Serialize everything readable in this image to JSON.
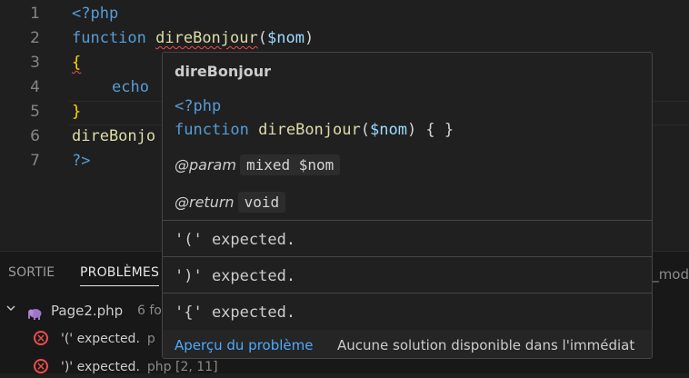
{
  "editor": {
    "lines": [
      {
        "num": "1"
      },
      {
        "num": "2"
      },
      {
        "num": "3"
      },
      {
        "num": "4"
      },
      {
        "num": "5"
      },
      {
        "num": "6"
      },
      {
        "num": "7"
      }
    ],
    "tok": {
      "php_open": "<?php",
      "kw_function": "function",
      "fn_name": "direBonjour",
      "paren_open": "(",
      "param": "$nom",
      "paren_close": ")",
      "brace_open": "{",
      "echo": "echo",
      "brace_close": "}",
      "call_partial": "direBonjo",
      "php_close": "?>"
    }
  },
  "hover": {
    "title": "direBonjour",
    "code_line1": "<?php",
    "code_kw": "function",
    "code_fn": "direBonjour",
    "code_paren_open": "(",
    "code_param": "$nom",
    "code_tail": ") { }",
    "param_tag": "@param",
    "param_value": "mixed $nom",
    "return_tag": "@return",
    "return_value": "void",
    "errors": [
      "'(' expected.",
      "')' expected.",
      "'{' expected."
    ],
    "footer_link": "Aperçu du problème",
    "footer_note": "Aucune solution disponible dans l'immédiat"
  },
  "panel": {
    "tab_output": "SORTIE",
    "tab_problems": "PROBLÈMES",
    "right_clip": "_mod",
    "file_name": "Page2.php",
    "file_count": "6 fo",
    "problems": [
      {
        "message": "'(' expected.",
        "location": "p"
      },
      {
        "message": "')' expected.",
        "location": "php  [2, 11]"
      }
    ]
  },
  "colors": {
    "keyword": "#569cd6",
    "function": "#dcdcaa",
    "variable": "#9cdcfe",
    "error": "#f14c4c",
    "link": "#4daafc"
  },
  "icons": {
    "php": "elephant-icon",
    "error": "error-circle-icon",
    "chevron": "chevron-down-icon"
  }
}
